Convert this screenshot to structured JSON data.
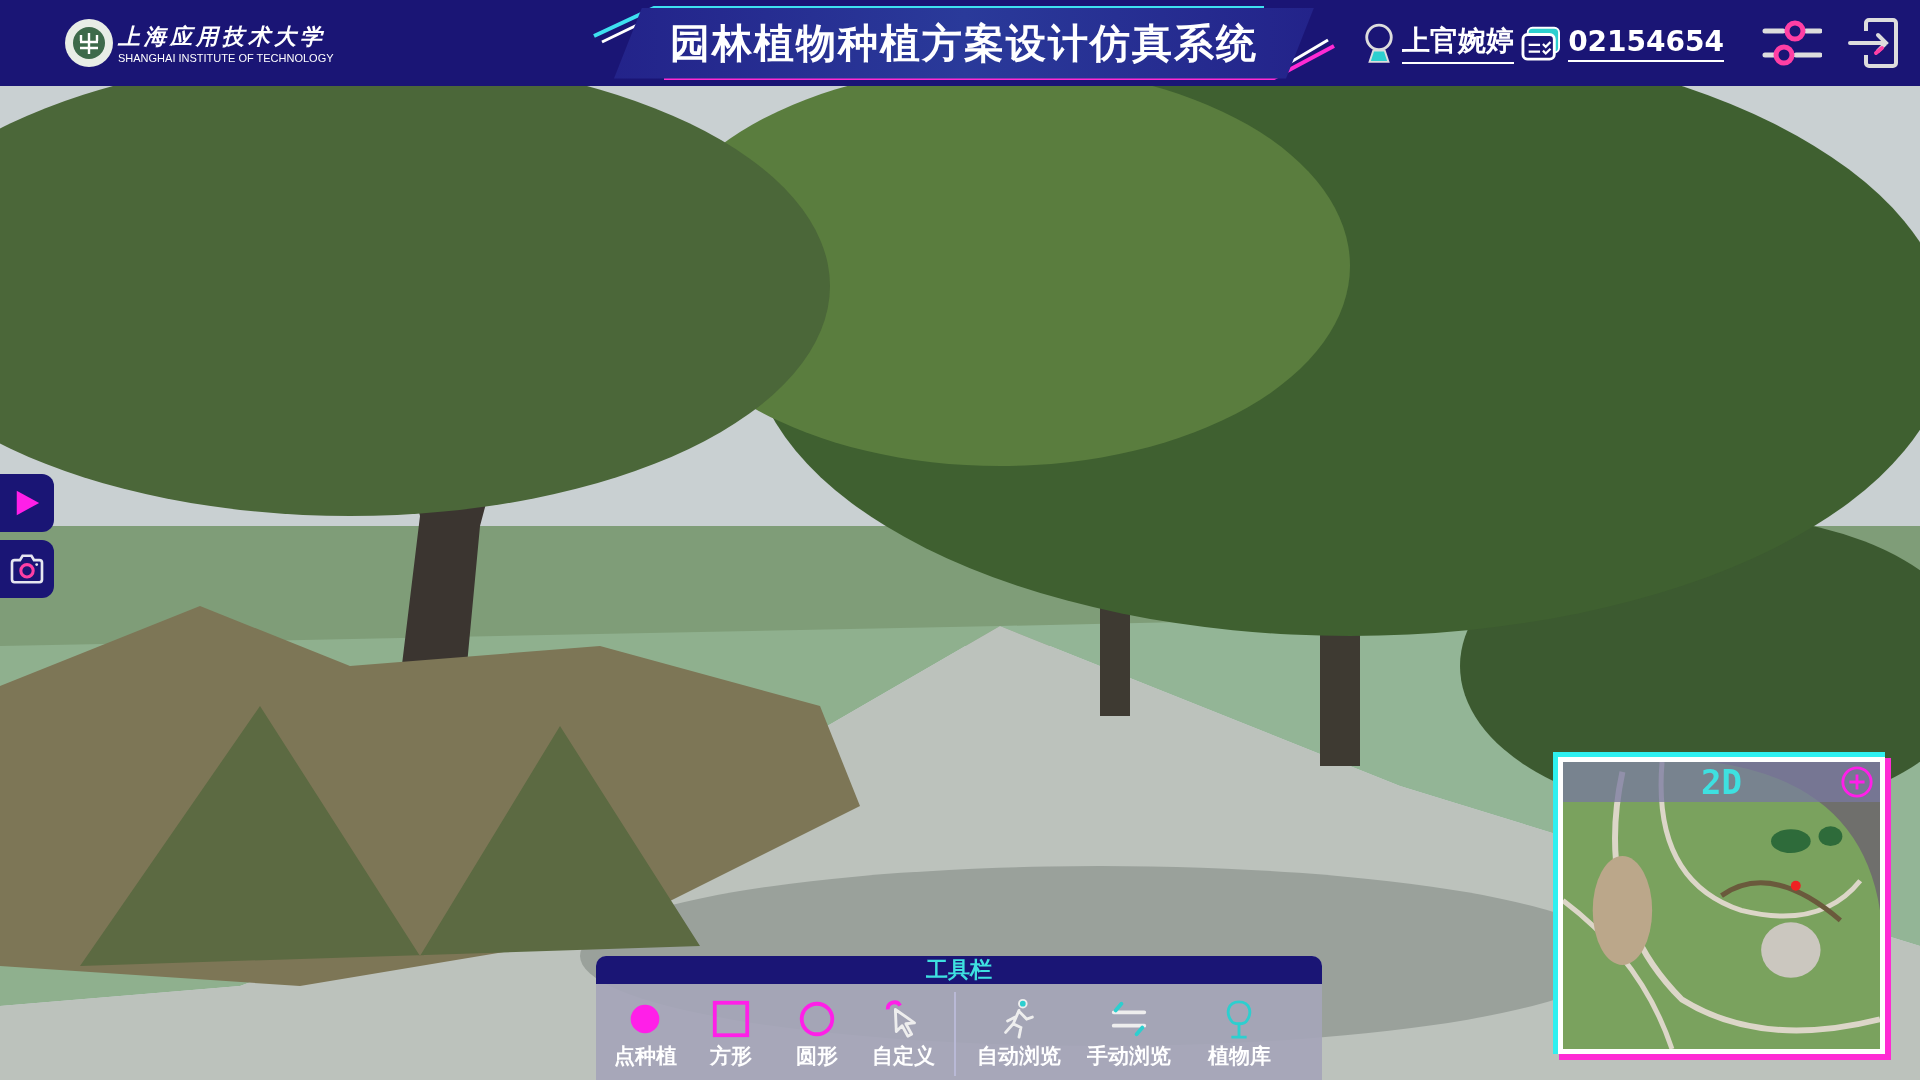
{
  "header": {
    "logo": {
      "name_cn": "上海应用技术大学",
      "name_en": "SHANGHAI INSTITUTE OF TECHNOLOGY"
    },
    "title": "园林植物种植方案设计仿真系统",
    "user": {
      "name": "上官婉婷",
      "id": "02154654"
    }
  },
  "side_buttons": [
    {
      "kind": "play"
    },
    {
      "kind": "camera"
    }
  ],
  "toolbar": {
    "title": "工具栏",
    "groups": [
      {
        "items": [
          {
            "kind": "dot",
            "label": "点种植"
          },
          {
            "kind": "square",
            "label": "方形"
          },
          {
            "kind": "circle",
            "label": "圆形"
          },
          {
            "kind": "custom",
            "label": "自定义"
          }
        ]
      },
      {
        "items": [
          {
            "kind": "walk",
            "label": "自动浏览"
          },
          {
            "kind": "swap",
            "label": "手动浏览"
          },
          {
            "kind": "tree",
            "label": "植物库"
          }
        ]
      }
    ]
  },
  "minimap": {
    "label": "2D"
  }
}
